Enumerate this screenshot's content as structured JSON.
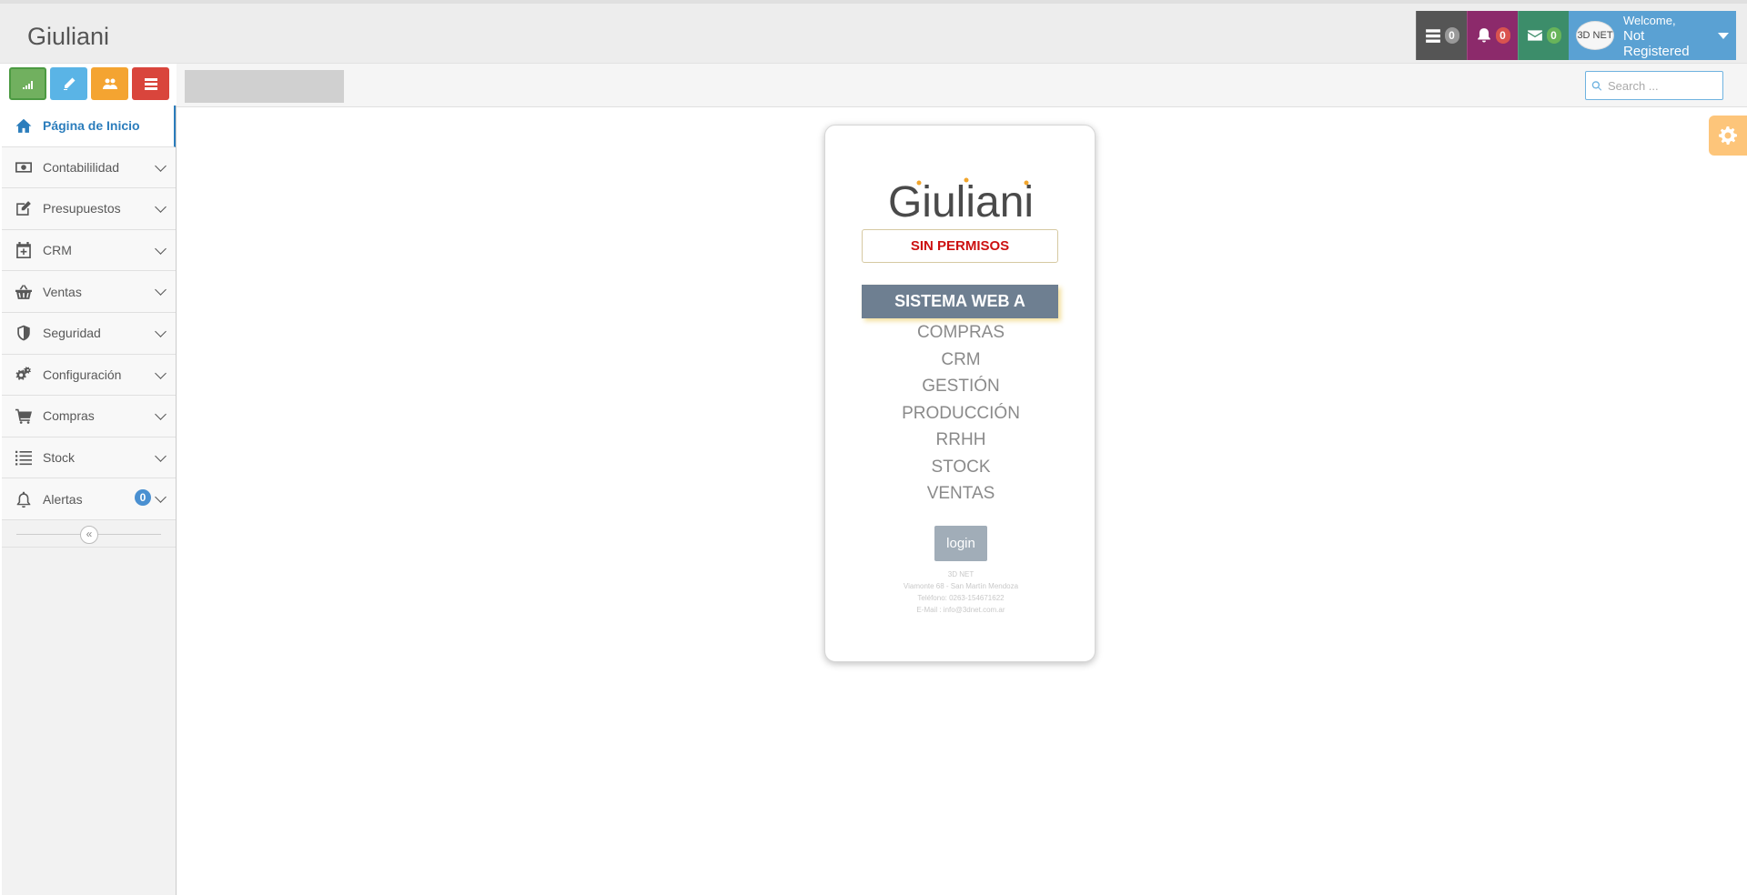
{
  "header": {
    "logo_text": "Giuliani",
    "tasks_count": "0",
    "notifications_count": "0",
    "messages_count": "0",
    "user": {
      "avatar_text": "3D NET",
      "greeting": "Welcome,",
      "name": "Not Registered"
    }
  },
  "toolbar": {
    "shortcuts": [
      {
        "icon": "signal-icon",
        "color": "#71b05f"
      },
      {
        "icon": "pencil-icon",
        "color": "#5ab4e6"
      },
      {
        "icon": "users-icon",
        "color": "#f4a431"
      },
      {
        "icon": "list-icon",
        "color": "#d9453c"
      }
    ],
    "search_placeholder": "Search ..."
  },
  "sidebar": {
    "items": [
      {
        "label": "Página de Inicio",
        "icon": "home-icon",
        "active": true
      },
      {
        "label": "Contabililidad",
        "icon": "money-icon"
      },
      {
        "label": "Presupuestos",
        "icon": "edit-icon"
      },
      {
        "label": "CRM",
        "icon": "calendar-plus-icon"
      },
      {
        "label": "Ventas",
        "icon": "basket-icon"
      },
      {
        "label": "Seguridad",
        "icon": "shield-icon"
      },
      {
        "label": "Configuración",
        "icon": "cogs-icon"
      },
      {
        "label": "Compras",
        "icon": "cart-icon"
      },
      {
        "label": "Stock",
        "icon": "list-icon"
      },
      {
        "label": "Alertas",
        "icon": "bell-icon",
        "badge": "0"
      }
    ],
    "collapse_symbol": "«"
  },
  "login_card": {
    "logo_text": "Giuliani",
    "status": "SIN PERMISOS",
    "headline": "SISTEMA WEB A MEDIDA",
    "modules": [
      "COMPRAS",
      "CRM",
      "GESTIÓN",
      "PRODUCCIÓN",
      "RRHH",
      "STOCK",
      "VENTAS"
    ],
    "login_label": "login",
    "footer": {
      "company": "3D NET",
      "address": "Viamonte 68 - San Martín Mendoza",
      "phone": "Teléfono: 0263-154671622",
      "email": "E-Mail : info@3dnet.com.ar"
    }
  },
  "colors": {
    "accent": "#2b7dbc",
    "status_red": "#cc1111",
    "headline_bg": "#6e7f91"
  }
}
